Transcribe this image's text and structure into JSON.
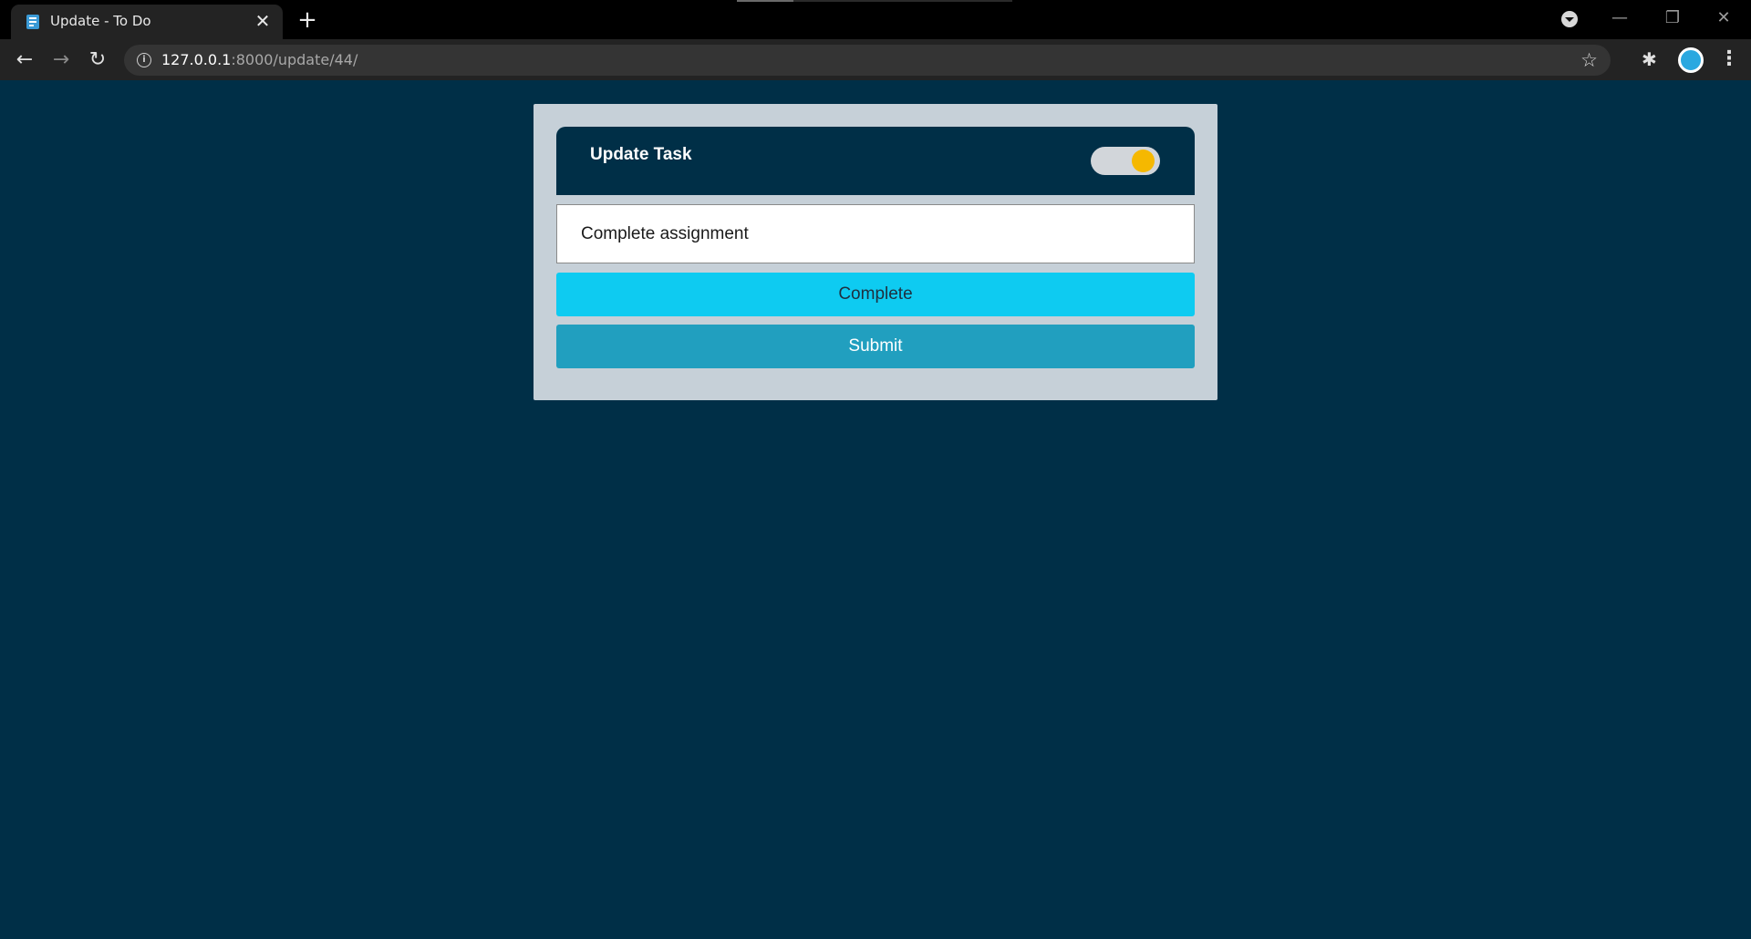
{
  "browser": {
    "tab": {
      "title": "Update - To Do",
      "close_glyph": "✕",
      "favicon_icon": "todo-favicon-icon"
    },
    "new_tab_glyph": "+",
    "window": {
      "minimize_glyph": "—",
      "restore_glyph": "❐",
      "close_glyph": "✕"
    },
    "nav": {
      "back_glyph": "←",
      "forward_glyph": "→",
      "reload_glyph": "↻"
    },
    "address": {
      "host": "127.0.0.1",
      "path": ":8000/update/44/",
      "info_glyph": "i",
      "star_glyph": "☆"
    },
    "extensions_glyph": "✱",
    "menu_glyph": "⋮"
  },
  "card": {
    "title": "Update Task",
    "toggle_on": true,
    "toggle_color": "#f5b800",
    "task_value": "Complete assignment",
    "complete_label": "Complete",
    "submit_label": "Submit",
    "colors": {
      "background": "#002f47",
      "card": "#c6d0d8",
      "complete": "#0ecbf1",
      "submit": "#219fbf"
    }
  }
}
